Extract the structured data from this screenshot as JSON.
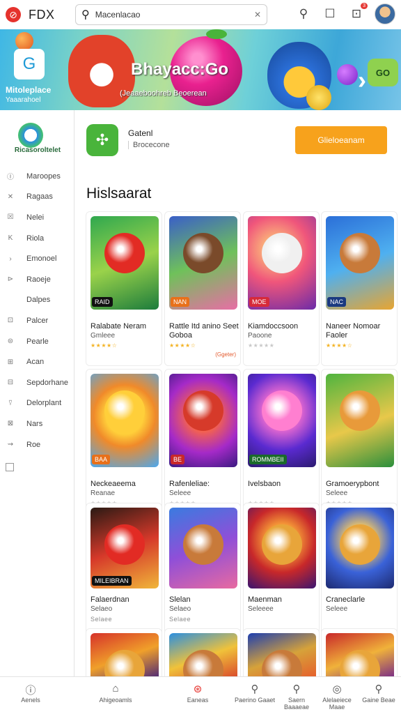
{
  "header": {
    "brand": "FDX",
    "search_placeholder": "Macenlacao",
    "notification_count": "3"
  },
  "banner": {
    "title": "Bhayacc:Go",
    "tagline": "(Jeaaeboohreb Beoerean",
    "logo_name": "Mitoleplace",
    "logo_sub": "Yaaarahoel",
    "gbox_label": "GO"
  },
  "sidebar": {
    "brand": "Ricasoroltelet",
    "items": [
      {
        "icon": "Ⓘ",
        "label": "Maroopes"
      },
      {
        "icon": "✕",
        "label": "Ragaas"
      },
      {
        "icon": "☒",
        "label": "Nelei"
      },
      {
        "icon": "K",
        "label": "Riola"
      },
      {
        "icon": "›",
        "label": "Emonoel"
      },
      {
        "icon": "⊳",
        "label": "Raoeje"
      },
      {
        "icon": "",
        "label": "Dalpes"
      },
      {
        "icon": "⊡",
        "label": "Palcer"
      },
      {
        "icon": "⊜",
        "label": "Pearle"
      },
      {
        "icon": "⊞",
        "label": "Acan"
      },
      {
        "icon": "⊟",
        "label": "Sepdorhane"
      },
      {
        "icon": "⍢",
        "label": "Delorplant"
      },
      {
        "icon": "⊠",
        "label": "Nars"
      },
      {
        "icon": "⇝",
        "label": "Roe"
      }
    ]
  },
  "promo": {
    "name": "Gatenl",
    "developer": "Brocecone",
    "button": "Glieloeanam"
  },
  "section_title": "Hislsaarat",
  "cards": [
    {
      "title": "Ralabate Neram",
      "sub": "Gmleee",
      "pill": "RAID",
      "stars": "★★★★☆",
      "dim": false,
      "tiny": ""
    },
    {
      "title": "Rattle Itd anino Seet Goboa",
      "sub": "",
      "pill": "NAN",
      "stars": "★★★★☆",
      "dim": false,
      "tiny": "(Ggeter)"
    },
    {
      "title": "Kiamdoccsoon",
      "sub": "Paoone",
      "pill": "MOE",
      "stars": "★★★★★",
      "dim": true,
      "tiny": ""
    },
    {
      "title": "Naneer Nomoar Faoler",
      "sub": "",
      "pill": "NAC",
      "stars": "★★★★☆",
      "dim": false,
      "tiny": ""
    },
    {
      "title": "Neckeaeema",
      "sub": "Reanae",
      "pill": "BAA",
      "stars": "★★★★★",
      "dim": true,
      "tiny": ""
    },
    {
      "title": "Rafenleliae:",
      "sub": "Seleee",
      "pill": "BE",
      "stars": "★★★★★",
      "dim": true,
      "tiny": ""
    },
    {
      "title": "Ivelsbaon",
      "sub": "",
      "pill": "ROMMBEII",
      "stars": "★★★★★",
      "dim": true,
      "tiny": ""
    },
    {
      "title": "Gramoerypbont",
      "sub": "Seleee",
      "pill": "",
      "stars": "★★★★★",
      "dim": true,
      "tiny": ""
    },
    {
      "title": "Falaerdnan",
      "sub": "Selaeo",
      "pill": "MILEIBRAN",
      "stars": "Selaee",
      "dim": true,
      "tiny": ""
    },
    {
      "title": "Slelan",
      "sub": "Selaeo",
      "pill": "",
      "stars": "Selaee",
      "dim": true,
      "tiny": ""
    },
    {
      "title": "Maenman",
      "sub": "Seleeee",
      "pill": "",
      "stars": "",
      "dim": true,
      "tiny": ""
    },
    {
      "title": "Craneclarle",
      "sub": "Seleee",
      "pill": "",
      "stars": "",
      "dim": true,
      "tiny": ""
    },
    {
      "title": "",
      "sub": "",
      "pill": "",
      "stars": "",
      "dim": true,
      "tiny": ""
    },
    {
      "title": "",
      "sub": "",
      "pill": "",
      "stars": "",
      "dim": true,
      "tiny": ""
    },
    {
      "title": "",
      "sub": "",
      "pill": "",
      "stars": "",
      "dim": true,
      "tiny": ""
    },
    {
      "title": "",
      "sub": "",
      "pill": "",
      "stars": "",
      "dim": true,
      "tiny": ""
    }
  ],
  "bottomnav": [
    {
      "icon": "ⓘ",
      "label": "Aenels"
    },
    {
      "icon": "⌂",
      "label": "Ahigeoamls"
    },
    {
      "icon": "⊛",
      "label": "Eaneas"
    },
    {
      "icon": "⚲",
      "label": "Paerino Gaaet"
    },
    {
      "icon": "⚲",
      "label": "Saern Baaaeae"
    },
    {
      "icon": "◎",
      "label": "Alelaeiece Maae"
    },
    {
      "icon": "⚲",
      "label": "Gaine Beae"
    }
  ],
  "colors": {
    "accent": "#f7a21c",
    "brand_red": "#e5322d",
    "green": "#49b43b"
  }
}
